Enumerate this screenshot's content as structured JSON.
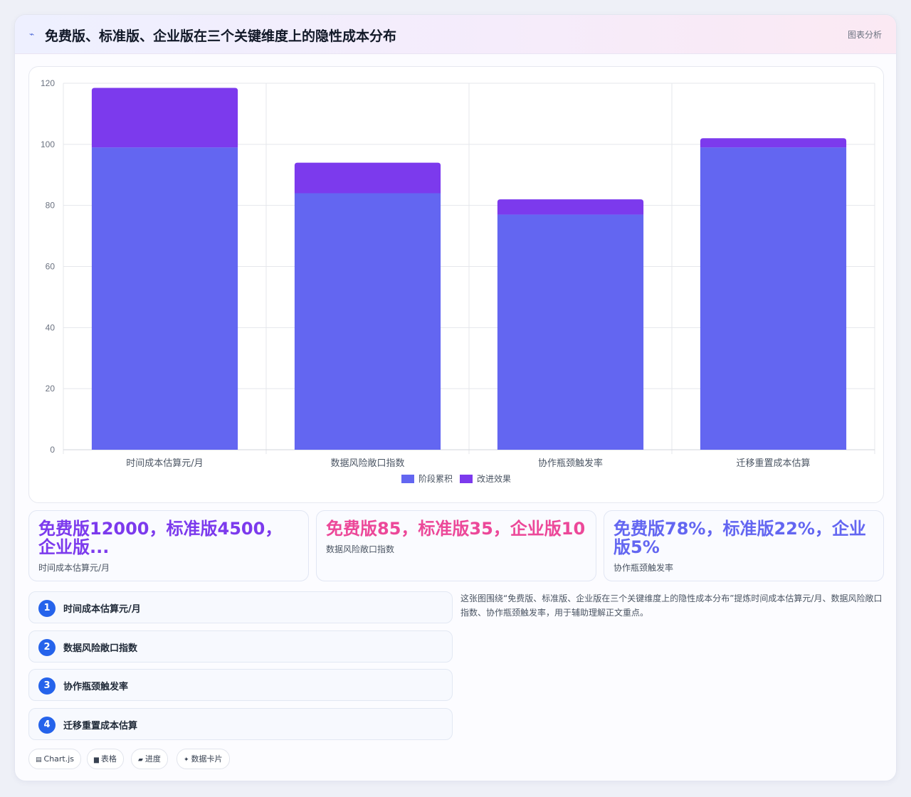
{
  "header": {
    "title": "免费版、标准版、企业版在三个关键维度上的隐性成本分布",
    "tag": "图表分析"
  },
  "chart_data": {
    "type": "bar",
    "stacked": true,
    "categories": [
      "时间成本估算元/月",
      "数据风险敞口指数",
      "协作瓶颈触发率",
      "迁移重置成本估算"
    ],
    "series": [
      {
        "name": "阶段累积",
        "values": [
          99,
          84,
          77,
          99
        ],
        "color": "#6366f1"
      },
      {
        "name": "改进效果",
        "values": [
          19.5,
          10,
          5,
          3
        ],
        "color": "#7c3aed"
      }
    ],
    "ylim": [
      0,
      120
    ],
    "yticks": [
      0,
      20,
      40,
      60,
      80,
      100,
      120
    ],
    "grid": true,
    "legend": "bottom"
  },
  "stats": [
    {
      "value": "免费版12000，标准版4500，企业版...",
      "label": "时间成本估算元/月",
      "color": "#7c3aed"
    },
    {
      "value": "免费版85，标准版35，企业版10",
      "label": "数据风险敞口指数",
      "color": "#ec4899"
    },
    {
      "value": "免费版78%，标准版22%，企业版5%",
      "label": "协作瓶颈触发率",
      "color": "#6366f1"
    }
  ],
  "steps": [
    {
      "num": "1",
      "label": "时间成本估算元/月"
    },
    {
      "num": "2",
      "label": "数据风险敞口指数"
    },
    {
      "num": "3",
      "label": "协作瓶颈触发率"
    },
    {
      "num": "4",
      "label": "迁移重置成本估算"
    }
  ],
  "description": "这张图围绕“免费版、标准版、企业版在三个关键维度上的隐性成本分布”提炼时间成本估算元/月、数据风险敞口指数、协作瓶颈触发率，用于辅助理解正文重点。",
  "chips": [
    {
      "icon": "table-icon",
      "label": "Chart.js"
    },
    {
      "icon": "grid-icon",
      "label": "表格"
    },
    {
      "icon": "progress-icon",
      "label": "进度"
    },
    {
      "icon": "sparkle-icon",
      "label": "数据卡片"
    }
  ]
}
